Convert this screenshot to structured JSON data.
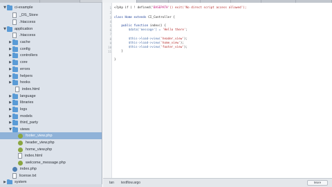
{
  "sidebar": {
    "items": [
      {
        "label": "ci-example",
        "icon": "folder-icon",
        "type": "folder",
        "state": "open",
        "selected": false
      },
      {
        "label": "_DS_Store",
        "icon": "file-icon",
        "type": "file",
        "state": "",
        "selected": false
      },
      {
        "label": ".htaccess",
        "icon": "file-icon",
        "type": "file",
        "state": "",
        "selected": false
      },
      {
        "label": "application",
        "icon": "folder-icon",
        "type": "folder",
        "state": "open",
        "selected": false
      },
      {
        "label": ".htaccess",
        "icon": "file-icon",
        "type": "file",
        "state": "",
        "selected": false
      },
      {
        "label": "cache",
        "icon": "folder-icon",
        "type": "folder",
        "state": "closed",
        "selected": false
      },
      {
        "label": "config",
        "icon": "folder-icon",
        "type": "folder",
        "state": "closed",
        "selected": false
      },
      {
        "label": "controllers",
        "icon": "folder-icon",
        "type": "folder",
        "state": "closed",
        "selected": false
      },
      {
        "label": "core",
        "icon": "folder-icon",
        "type": "folder",
        "state": "closed",
        "selected": false
      },
      {
        "label": "errors",
        "icon": "folder-icon",
        "type": "folder",
        "state": "closed",
        "selected": false
      },
      {
        "label": "helpers",
        "icon": "folder-icon",
        "type": "folder",
        "state": "closed",
        "selected": false
      },
      {
        "label": "hooks",
        "icon": "folder-icon",
        "type": "folder",
        "state": "closed",
        "selected": false
      },
      {
        "label": "index.html",
        "icon": "file-icon",
        "type": "file",
        "state": "",
        "selected": false
      },
      {
        "label": "language",
        "icon": "folder-icon",
        "type": "folder",
        "state": "closed",
        "selected": false
      },
      {
        "label": "libraries",
        "icon": "folder-icon",
        "type": "folder",
        "state": "closed",
        "selected": false
      },
      {
        "label": "logs",
        "icon": "folder-icon",
        "type": "folder",
        "state": "closed",
        "selected": false
      },
      {
        "label": "models",
        "icon": "folder-icon",
        "type": "folder",
        "state": "closed",
        "selected": false
      },
      {
        "label": "third_party",
        "icon": "folder-icon",
        "type": "folder",
        "state": "closed",
        "selected": false
      },
      {
        "label": "views",
        "icon": "folder-icon",
        "type": "folder",
        "state": "open",
        "selected": false
      },
      {
        "label": "footer_view.php",
        "icon": "php-file-icon",
        "type": "php",
        "state": "",
        "selected": true
      },
      {
        "label": "header_view.php",
        "icon": "php-file-icon",
        "type": "php",
        "state": "",
        "selected": false
      },
      {
        "label": "home_view.php",
        "icon": "php-file-icon",
        "type": "php",
        "state": "",
        "selected": false
      },
      {
        "label": "index.html",
        "icon": "file-icon",
        "type": "file",
        "state": "",
        "selected": false
      },
      {
        "label": "welcome_message.php",
        "icon": "php-file-icon",
        "type": "php",
        "state": "",
        "selected": false
      },
      {
        "label": "index.php",
        "icon": "php-file-icon",
        "type": "php",
        "state": "",
        "selected": false
      },
      {
        "label": "license.txt",
        "icon": "file-icon",
        "type": "file",
        "state": "",
        "selected": false
      },
      {
        "label": "system",
        "icon": "folder-icon",
        "type": "folder",
        "state": "closed",
        "selected": false
      },
      {
        "label": "user_guide",
        "icon": "folder-icon",
        "type": "folder",
        "state": "closed",
        "selected": false
      }
    ]
  },
  "editor": {
    "line_numbers": [
      "1",
      "2",
      "3",
      "4",
      "5",
      "6",
      "7",
      "8",
      "9",
      "10",
      "11"
    ],
    "code": {
      "l1_a": "<?php if ( ! defined('",
      "l1_b": "BASEPATH",
      "l1_c": "')) exit('No direct script access allowed');",
      "l3_a": "class ",
      "l3_b": "Home",
      "l3_c": " extends ",
      "l3_d": "CI_Controller",
      "l3_e": " {",
      "l5_a": "    public function ",
      "l5_b": "index",
      "l5_c": "() {",
      "l6_a": "        $data['message'] = ",
      "l6_b": "'Hello there'",
      "l6_c": ";",
      "l8_a": "        $this->load->view(",
      "l8_b": "'header_view'",
      "l8_c": ");",
      "l9_a": "        $this->load->view(",
      "l9_b": "'home_view'",
      "l9_c": ");",
      "l10_a": "        $this->load->view(",
      "l10_b": "'footer_view'",
      "l10_c": ");",
      "l11": "    }",
      "l12": "}"
    }
  },
  "statusbar": {
    "mode": "tan",
    "file": "textflow.argo",
    "more_label": "More"
  },
  "colors": {
    "sidebar_bg": "#dde3eb",
    "selection": "#8fb2d8",
    "folder": "#5a9bd6",
    "php_icon": "#8ba641",
    "keyword": "#1b3e96",
    "string": "#b32b2b"
  }
}
